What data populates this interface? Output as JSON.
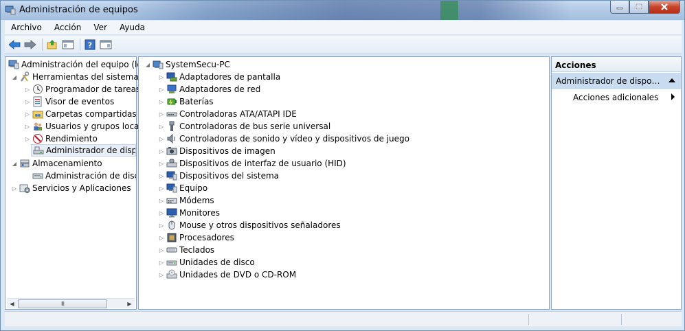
{
  "window": {
    "title": "Administración de equipos"
  },
  "menu": [
    "Archivo",
    "Acción",
    "Ver",
    "Ayuda"
  ],
  "toolbar": [
    "back-icon",
    "forward-icon",
    "up-folder-icon",
    "show-hide-tree-icon",
    "help-icon",
    "show-hide-action-pane-icon"
  ],
  "left_tree": {
    "root": "Administración del equipo (local)",
    "items": [
      {
        "label": "Herramientas del sistema",
        "icon": "tools-icon"
      },
      {
        "label": "Programador de tareas",
        "icon": "clock-icon"
      },
      {
        "label": "Visor de eventos",
        "icon": "event-viewer-icon"
      },
      {
        "label": "Carpetas compartidas",
        "icon": "shared-folder-icon"
      },
      {
        "label": "Usuarios y grupos locales",
        "icon": "users-icon"
      },
      {
        "label": "Rendimiento",
        "icon": "performance-icon"
      },
      {
        "label": "Administrador de dispositivos",
        "icon": "device-manager-icon"
      },
      {
        "label": "Almacenamiento",
        "icon": "storage-icon"
      },
      {
        "label": "Administración de discos",
        "icon": "disk-icon"
      },
      {
        "label": "Servicios y Aplicaciones",
        "icon": "services-icon"
      }
    ],
    "scroll_thumb": "III"
  },
  "device_tree": {
    "root": "SystemSecu-PC",
    "items": [
      "Adaptadores de pantalla",
      "Adaptadores de red",
      "Baterías",
      "Controladoras ATA/ATAPI IDE",
      "Controladoras de bus serie universal",
      "Controladoras de sonido y vídeo y dispositivos de juego",
      "Dispositivos de imagen",
      "Dispositivos de interfaz de usuario (HID)",
      "Dispositivos del sistema",
      "Equipo",
      "Módems",
      "Monitores",
      "Mouse y otros dispositivos señaladores",
      "Procesadores",
      "Teclados",
      "Unidades de disco",
      "Unidades de DVD o CD-ROM"
    ]
  },
  "actions": {
    "header": "Acciones",
    "section": "Administrador de dispositivos",
    "item": "Acciones adicionales"
  }
}
